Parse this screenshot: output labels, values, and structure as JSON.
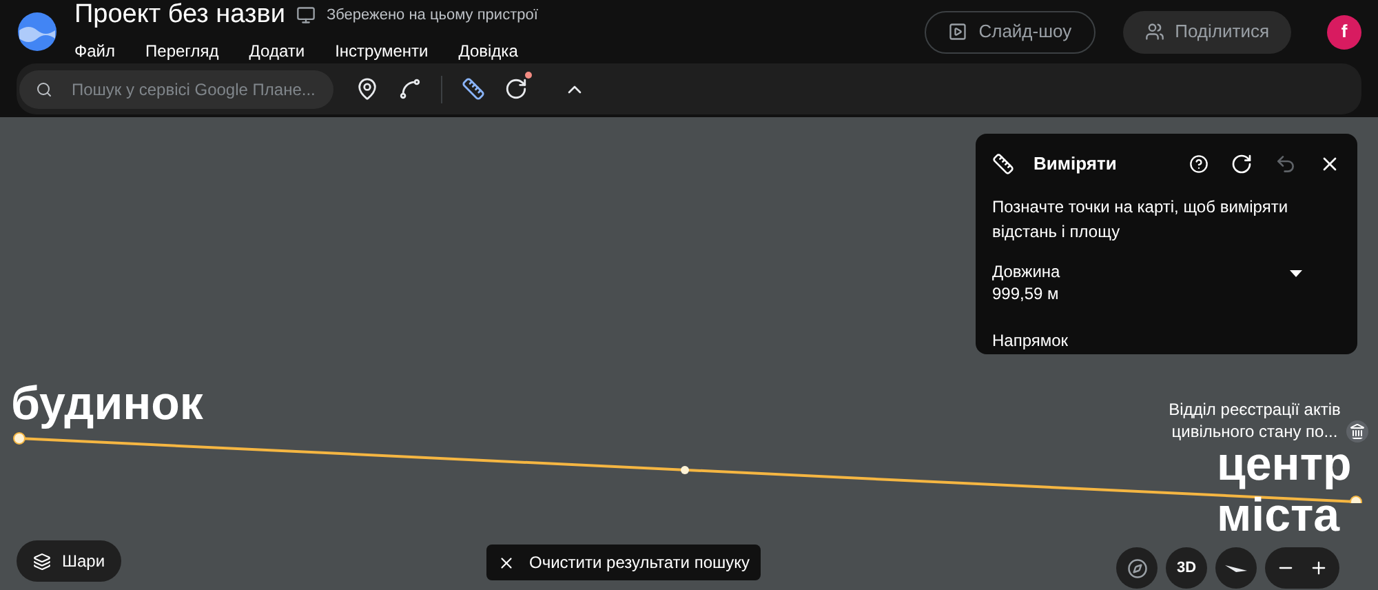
{
  "header": {
    "title": "Проект без назви",
    "save_status": "Збережено на цьому пристрої",
    "menu": [
      "Файл",
      "Перегляд",
      "Додати",
      "Інструменти",
      "Довідка"
    ],
    "slideshow_button": "Слайд-шоу",
    "share_button": "Поділитися",
    "avatar": "f"
  },
  "toolbar": {
    "search": {
      "placeholder": "Пошук у сервісі Google Плане..."
    },
    "notification_dot": true
  },
  "measure_panel": {
    "title": "Виміряти",
    "hint": "Позначте точки на карті, щоб виміряти відстань і площу",
    "length_label": "Довжина",
    "length_value": "999,59 м",
    "direction_label": "Напрямок"
  },
  "map": {
    "start_label": "будинок",
    "end_label_lines": [
      "центр",
      "міста"
    ],
    "place_label": "Відділ реєстрації актів цивільного стану по..."
  },
  "bottom": {
    "layers_button": "Шари",
    "clear_button": "Очистити результати пошуку",
    "view_3d": "3D"
  }
}
